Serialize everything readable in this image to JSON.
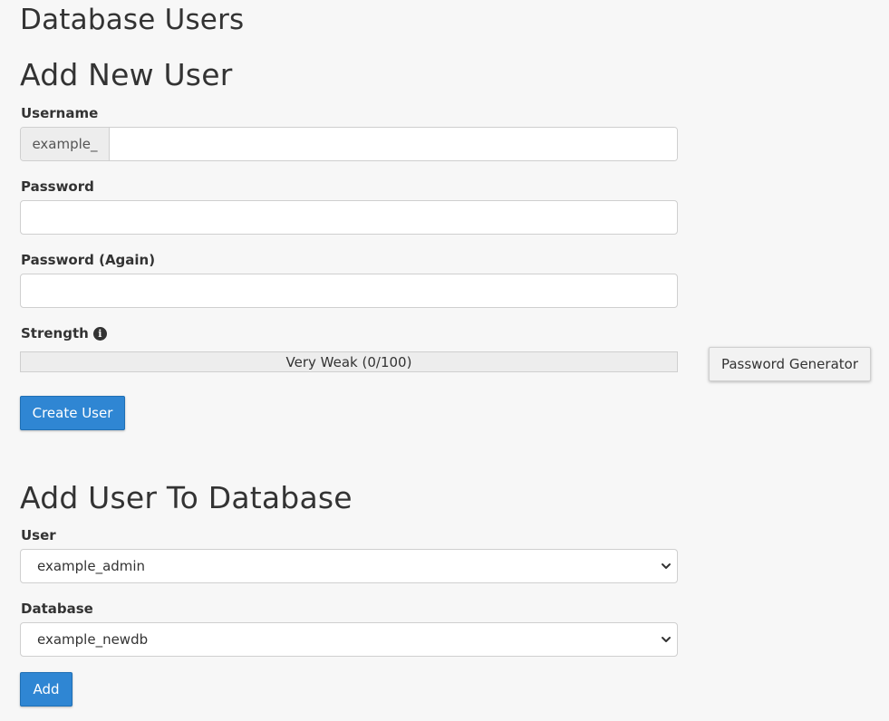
{
  "page": {
    "title": "Database Users"
  },
  "add_user": {
    "heading": "Add New User",
    "username": {
      "label": "Username",
      "prefix": "example_",
      "value": ""
    },
    "password": {
      "label": "Password",
      "value": ""
    },
    "password_again": {
      "label": "Password (Again)",
      "value": ""
    },
    "strength": {
      "label": "Strength",
      "text": "Very Weak (0/100)",
      "value": 0,
      "icon": "info-circle-icon"
    },
    "generator_button": "Password Generator",
    "create_button": "Create User"
  },
  "add_to_db": {
    "heading": "Add User To Database",
    "user": {
      "label": "User",
      "selected": "example_admin"
    },
    "database": {
      "label": "Database",
      "selected": "example_newdb"
    },
    "add_button": "Add"
  },
  "colors": {
    "background": "#f7f7f7",
    "primary_button": "#2f86d3",
    "text": "#333333"
  }
}
